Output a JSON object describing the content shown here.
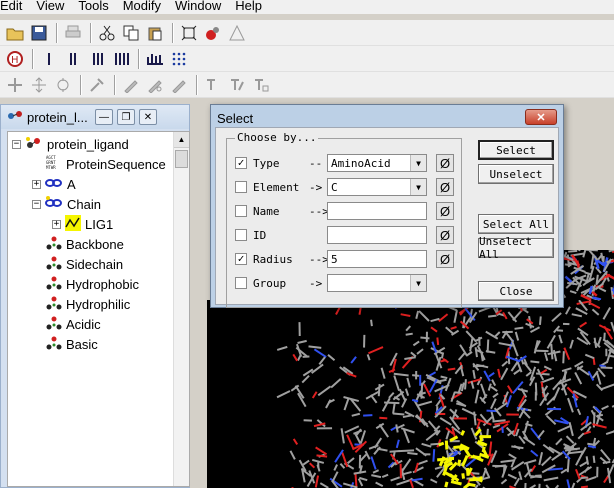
{
  "menu": [
    "Edit",
    "View",
    "Tools",
    "Modify",
    "Window",
    "Help"
  ],
  "panel": {
    "title": "protein_l...",
    "min_btn": "—",
    "restore_btn": "❐",
    "close_btn": "✕"
  },
  "tree": {
    "root": "protein_ligand",
    "items": [
      {
        "label": "ProteinSequence"
      },
      {
        "label": "A"
      },
      {
        "label": "Chain"
      },
      {
        "label": "LIG1"
      },
      {
        "label": "Backbone"
      },
      {
        "label": "Sidechain"
      },
      {
        "label": "Hydrophobic"
      },
      {
        "label": "Hydrophilic"
      },
      {
        "label": "Acidic"
      },
      {
        "label": "Basic"
      }
    ]
  },
  "dialog": {
    "title": "Select",
    "close": "✕",
    "group_label": "Choose by...",
    "rows": [
      {
        "label": "Type",
        "arrow": "--",
        "checked": true,
        "value": "AminoAcid",
        "dropdown": true
      },
      {
        "label": "Element",
        "arrow": "->",
        "checked": false,
        "value": "C",
        "dropdown": true
      },
      {
        "label": "Name",
        "arrow": "-->",
        "checked": false,
        "value": "",
        "dropdown": false
      },
      {
        "label": "ID",
        "arrow": "",
        "checked": false,
        "value": "",
        "dropdown": false
      },
      {
        "label": "Radius",
        "arrow": "-->",
        "checked": true,
        "value": "5",
        "dropdown": false
      },
      {
        "label": "Group",
        "arrow": "->",
        "checked": false,
        "value": "",
        "dropdown": true
      }
    ],
    "null_symbol": "Ø",
    "buttons": {
      "select": "Select",
      "unselect": "Unselect",
      "select_all": "Select All",
      "unselect_all": "Unselect All",
      "close": "Close"
    }
  },
  "colors": {
    "viewer_bg": "#000000",
    "carbon": "#a0a0a0",
    "oxygen": "#e02020",
    "nitrogen": "#3050f0",
    "ligand": "#f5f500"
  }
}
